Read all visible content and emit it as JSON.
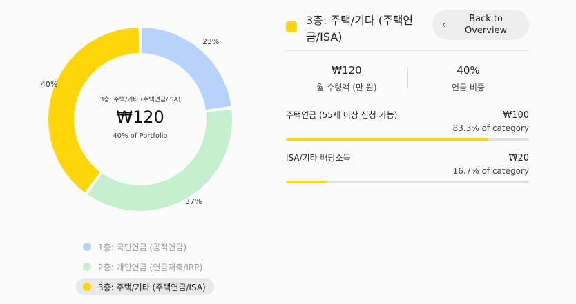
{
  "donut": {
    "center_title": "3층: 주택/기타 (주택연금/ISA)",
    "center_value": "₩120",
    "center_sub": "40% of Portfolio"
  },
  "chart_data": {
    "type": "pie",
    "categories": [
      "1층: 국민연금 (공적연금)",
      "2층: 개인연금 (연금저축/IRP)",
      "3층: 주택/기타 (주택연금/ISA)"
    ],
    "values": [
      23,
      37,
      40
    ],
    "labels": [
      "23%",
      "37%",
      "40%"
    ],
    "colors": [
      "#b7d3fb",
      "#c6efcf",
      "#ffd60a"
    ],
    "legend_placement": "bottom"
  },
  "legend": [
    {
      "label": "1층: 국민연금 (공적연금)",
      "color": "#b7d3fb",
      "active": false
    },
    {
      "label": "2층: 개인연금 (연금저축/IRP)",
      "color": "#c6efcf",
      "active": false
    },
    {
      "label": "3층: 주택/기타 (주택연금/ISA)",
      "color": "#ffd60a",
      "active": true
    }
  ],
  "detail": {
    "title": "3층: 주택/기타 (주택연금/ISA)",
    "accent": "#ffd60a",
    "back_label": "Back to Overview",
    "stats": [
      {
        "value": "₩120",
        "label": "월 수령액 (만 원)"
      },
      {
        "value": "40%",
        "label": "연금 비중"
      }
    ],
    "items": [
      {
        "name": "주택연금 (55세 이상 신청 가능)",
        "value": "₩100",
        "pct": "83.3% of category",
        "fraction": 0.833
      },
      {
        "name": "ISA/기타 배당소득",
        "value": "₩20",
        "pct": "16.7% of category",
        "fraction": 0.167
      }
    ]
  }
}
